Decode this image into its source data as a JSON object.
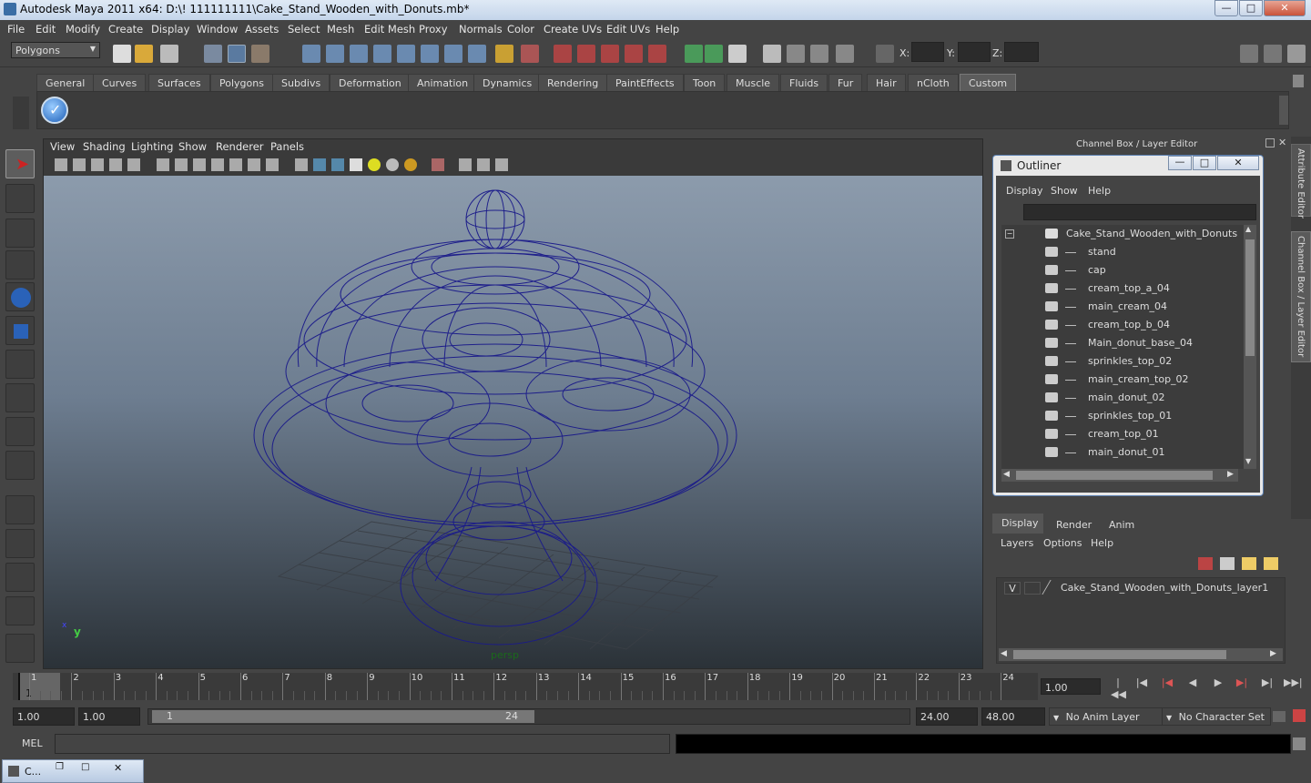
{
  "window": {
    "title": "Autodesk Maya 2011 x64: D:\\! 111111111\\Cake_Stand_Wooden_with_Donuts.mb*",
    "minimize": "—",
    "maximize": "□",
    "close": "✕"
  },
  "menus": [
    "File",
    "Edit",
    "Modify",
    "Create",
    "Display",
    "Window",
    "Assets",
    "Select",
    "Mesh",
    "Edit Mesh",
    "Proxy",
    "Normals",
    "Color",
    "Create UVs",
    "Edit UVs",
    "Help"
  ],
  "status": {
    "mode": "Polygons",
    "x_label": "X:",
    "y_label": "Y:",
    "z_label": "Z:"
  },
  "shelf_tabs": [
    "General",
    "Curves",
    "Surfaces",
    "Polygons",
    "Subdivs",
    "Deformation",
    "Animation",
    "Dynamics",
    "Rendering",
    "PaintEffects",
    "Toon",
    "Muscle",
    "Fluids",
    "Fur",
    "Hair",
    "nCloth",
    "Custom"
  ],
  "shelf_active": "Custom",
  "viewport_menu": [
    "View",
    "Shading",
    "Lighting",
    "Show",
    "Renderer",
    "Panels"
  ],
  "viewport_footer": "persp",
  "axis": {
    "y": "y",
    "x": "x"
  },
  "channel_box_title": "Channel Box / Layer Editor",
  "outliner": {
    "title": "Outliner",
    "menu": [
      "Display",
      "Show",
      "Help"
    ],
    "root": "Cake_Stand_Wooden_with_Donuts",
    "items": [
      "stand",
      "cap",
      "cream_top_a_04",
      "main_cream_04",
      "cream_top_b_04",
      "Main_donut_base_04",
      "sprinkles_top_02",
      "main_cream_top_02",
      "main_donut_02",
      "sprinkles_top_01",
      "cream_top_01",
      "main_donut_01"
    ]
  },
  "layer_editor": {
    "tabs": [
      "Display",
      "Render",
      "Anim"
    ],
    "active": "Display",
    "menu": [
      "Layers",
      "Options",
      "Help"
    ],
    "layer": {
      "visible": "V",
      "name": "Cake_Stand_Wooden_with_Donuts_layer1"
    }
  },
  "side_tabs": [
    "Attribute Editor",
    "Channel Box / Layer Editor"
  ],
  "timeline": {
    "ticks": [
      "1",
      "2",
      "3",
      "4",
      "5",
      "6",
      "7",
      "8",
      "9",
      "10",
      "11",
      "12",
      "13",
      "14",
      "15",
      "16",
      "17",
      "18",
      "19",
      "20",
      "21",
      "22",
      "23",
      "24"
    ],
    "current_frame": "1.00",
    "playhead": "1"
  },
  "range": {
    "start": "1.00",
    "start2": "1.00",
    "slider_start": "1",
    "slider_end": "24",
    "end": "24.00",
    "end2": "48.00",
    "anim_layer": "No Anim Layer",
    "char_set": "No Character Set"
  },
  "cmd": {
    "label": "MEL"
  },
  "taskbar": {
    "label": "C..."
  }
}
